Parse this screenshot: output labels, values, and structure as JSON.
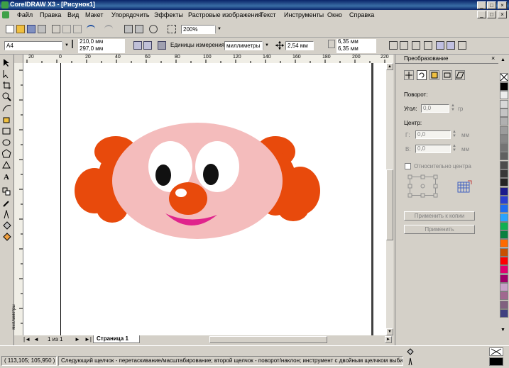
{
  "window": {
    "title": "CorelDRAW X3 - [Рисунок1]"
  },
  "menu": [
    "Файл",
    "Правка",
    "Вид",
    "Макет",
    "Упорядочить",
    "Эффекты",
    "Растровые изображения",
    "Текст",
    "Инструменты",
    "Окно",
    "Справка"
  ],
  "standard_toolbar": {
    "zoom": "200%"
  },
  "property_bar": {
    "paper": "A4",
    "width": "210,0 мм",
    "height": "297,0 мм",
    "units_label": "Единицы измерения:",
    "units_value": "миллиметры",
    "nudge": "2,54 мм",
    "dup_x": "6,35 мм",
    "dup_y": "6,35 мм"
  },
  "ruler": {
    "h_labels": [
      "20",
      "0",
      "20",
      "40",
      "60",
      "80",
      "100",
      "120",
      "140",
      "160",
      "180",
      "200",
      "220"
    ],
    "v_labels": [
      "миллиметры"
    ]
  },
  "page_nav": {
    "counter": "1 из 1",
    "tab": "Страница 1"
  },
  "docker": {
    "title": "Преобразование",
    "rotation_label": "Поворот:",
    "angle_label": "Угол:",
    "angle_value": "0,0",
    "angle_unit": "гр",
    "center_label": "Центр:",
    "h_label": "Г:",
    "h_value": "0,0",
    "v_label": "В:",
    "v_value": "0,0",
    "unit": "мм",
    "relative_center": "Относительно центра",
    "apply_copy": "Применить к копии",
    "apply": "Применить"
  },
  "palette": [
    "#ffffff",
    "#000000",
    "#ececec",
    "#d8d8d8",
    "#c4c4c4",
    "#b0b0b0",
    "#9c9c9c",
    "#888888",
    "#747474",
    "#606060",
    "#4c4c4c",
    "#383838",
    "#242424",
    "#1a1a8c",
    "#2a3fd0",
    "#1e6cf0",
    "#29a3ff",
    "#10b050",
    "#0a8040",
    "#ff6a00",
    "#c85000",
    "#ff0000",
    "#e0006e",
    "#a0006a",
    "#c8a0c8",
    "#a06890",
    "#806080",
    "#404080"
  ],
  "status": {
    "coords": "( 113,105; 105,950 )",
    "hint": "Следующий щелчок - перетаскивание/масштабирование; второй щелчок - поворот/наклон; инструмент с двойным щелчком выбира..."
  }
}
